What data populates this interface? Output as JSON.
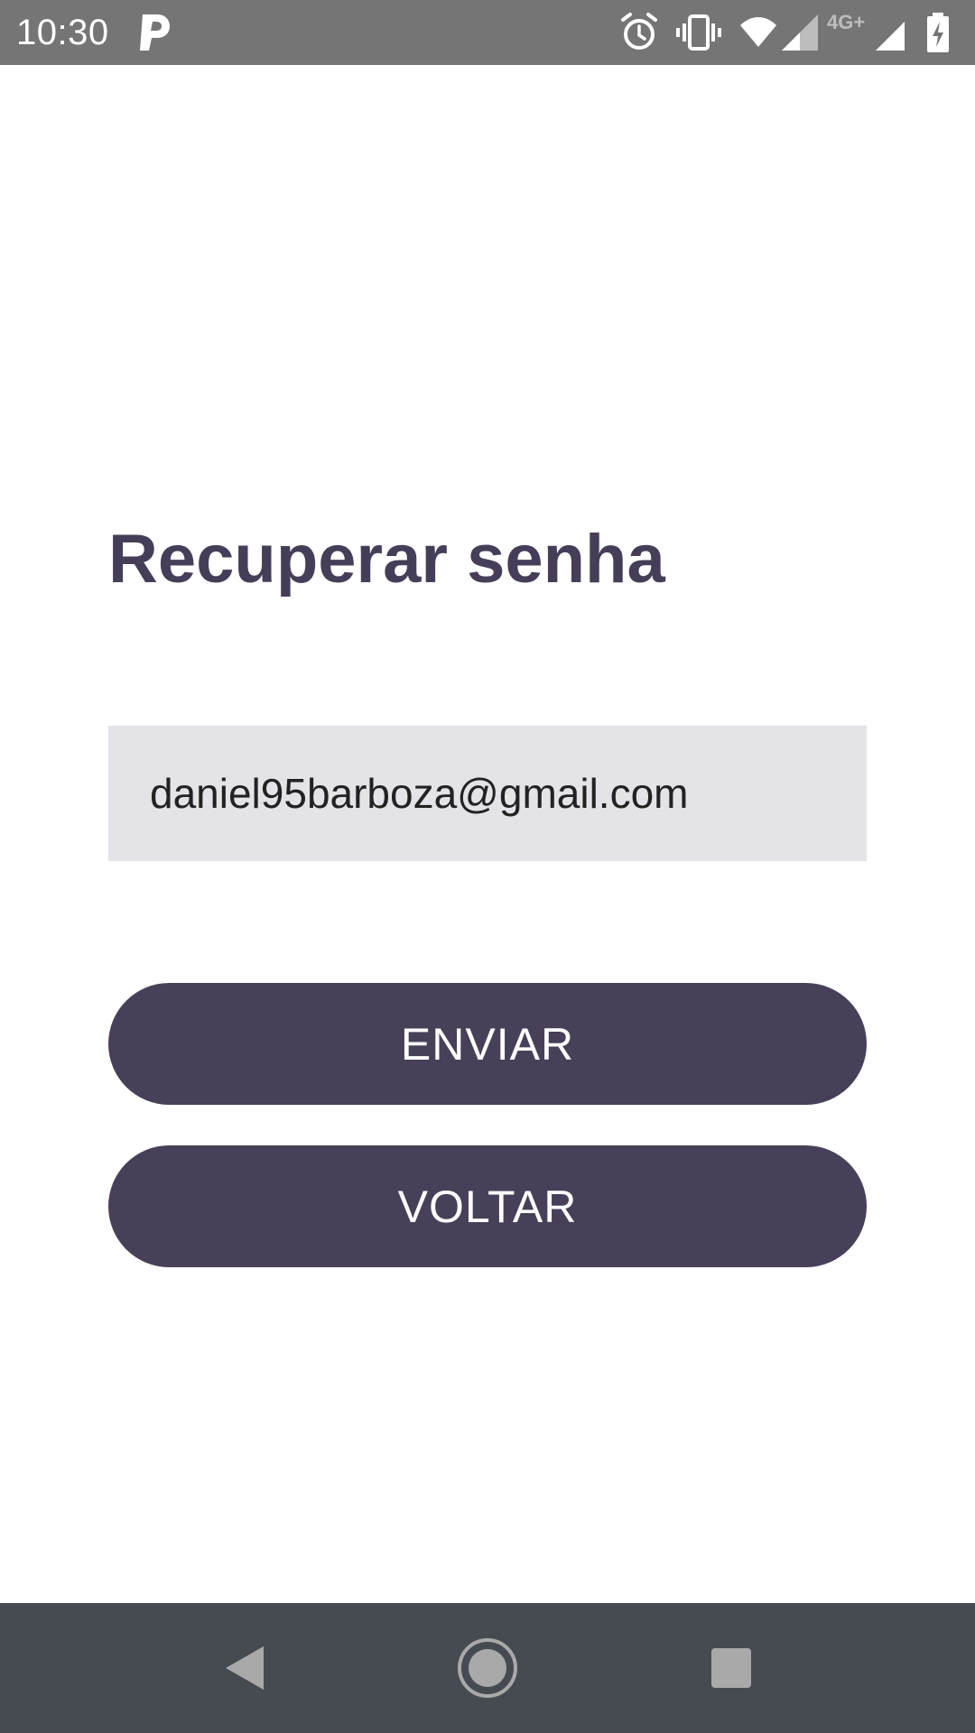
{
  "status_bar": {
    "time": "10:30",
    "network_label": "4G+"
  },
  "screen": {
    "title": "Recuperar senha",
    "email_value": "daniel95barboza@gmail.com"
  },
  "buttons": {
    "send_label": "ENVIAR",
    "back_label": "VOLTAR"
  },
  "colors": {
    "accent": "#483f58",
    "title": "#463e58",
    "field_background": "#e3e3e8",
    "status_bar": "#757575",
    "nav_bar": "#454b51"
  },
  "icons": {
    "status_notification": "parking-app-icon",
    "alarm": "alarm-icon",
    "vibrate": "vibrate-icon",
    "wifi": "wifi-icon",
    "signal": "cell-signal-icon",
    "battery": "battery-charging-icon",
    "nav_back": "back-triangle-icon",
    "nav_home": "home-circle-icon",
    "nav_recents": "recents-square-icon"
  }
}
